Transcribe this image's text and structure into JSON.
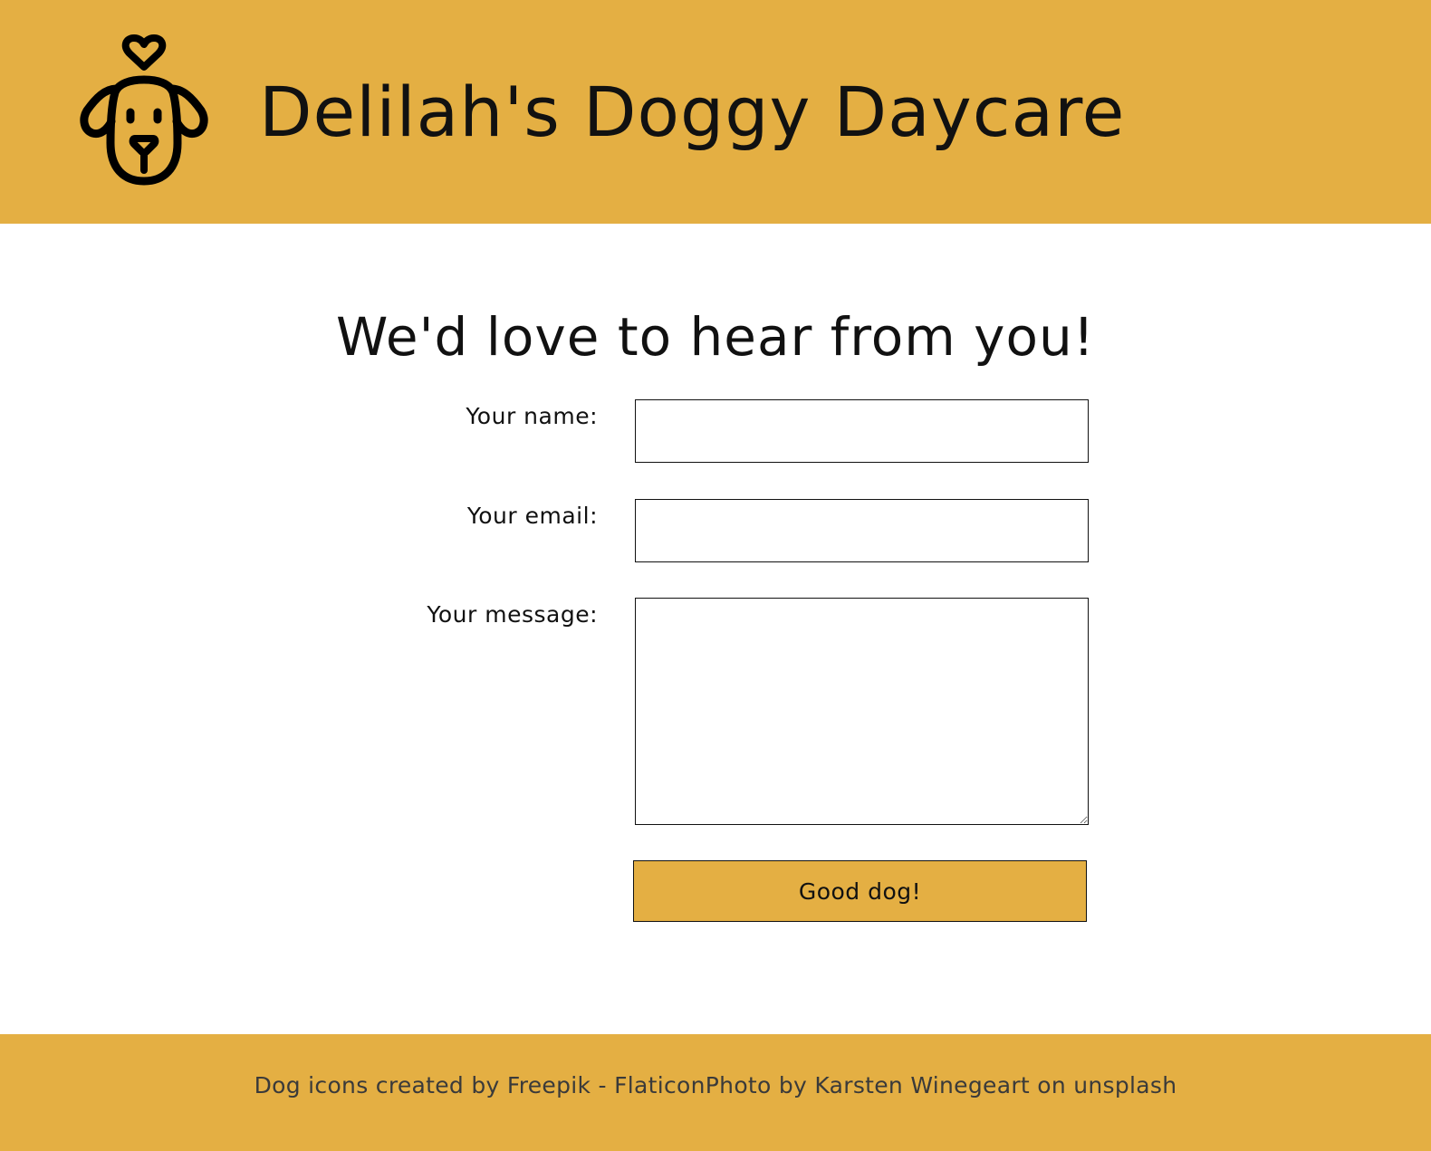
{
  "header": {
    "title": "Delilah's Doggy Daycare",
    "logo_icon": "dog-heart-icon",
    "background_color": "#E4AF43"
  },
  "main": {
    "heading": "We'd love to hear from you!",
    "form": {
      "name_label": "Your name:",
      "name_value": "",
      "email_label": "Your email:",
      "email_value": "",
      "message_label": "Your message:",
      "message_value": "",
      "submit_label": "Good dog!"
    }
  },
  "footer": {
    "credits": "Dog icons created by Freepik - FlaticonPhoto by Karsten Winegeart on unsplash",
    "background_color": "#E4AF43"
  }
}
